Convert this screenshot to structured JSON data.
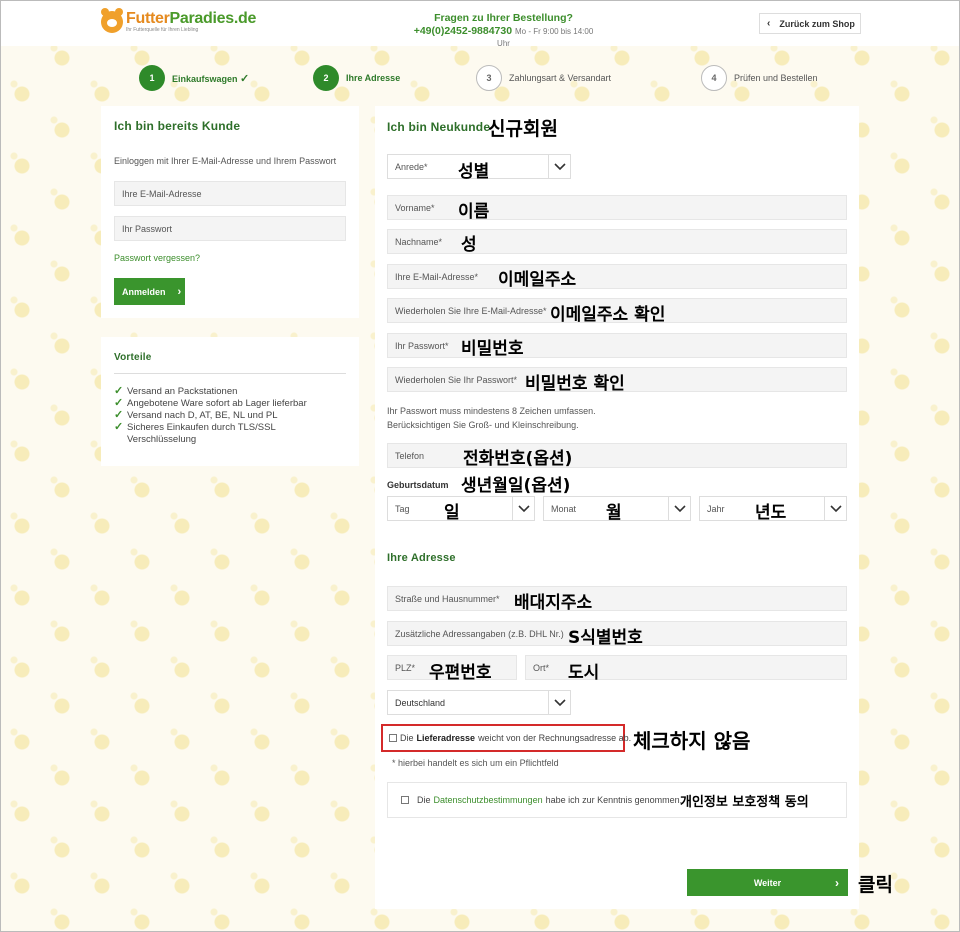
{
  "header": {
    "logo_name_a": "Futter",
    "logo_name_b": "Paradies.de",
    "logo_slogan": "Ihr Futterquelle für Ihren Liebling",
    "contact_question": "Fragen zu Ihrer Bestellung?",
    "contact_phone": "+49(0)2452-9884730",
    "contact_hours": "Mo - Fr 9:00 bis 14:00 Uhr",
    "back_label": "Zurück zum Shop"
  },
  "steps": [
    {
      "number": "1",
      "label": "Einkaufswagen",
      "check": "✓"
    },
    {
      "number": "2",
      "label": "Ihre Adresse"
    },
    {
      "number": "3",
      "label": "Zahlungsart & Versandart"
    },
    {
      "number": "4",
      "label": "Prüfen und Bestellen"
    }
  ],
  "login": {
    "title": "Ich bin bereits Kunde",
    "intro": "Einloggen mit Ihrer E-Mail-Adresse und Ihrem Passwort",
    "email_placeholder": "Ihre E-Mail-Adresse",
    "password_placeholder": "Ihr Passwort",
    "forgot": "Passwort vergessen?",
    "submit": "Anmelden"
  },
  "benefits": {
    "title": "Vorteile",
    "items": [
      "Versand an Packstationen",
      "Angebotene Ware sofort ab Lager lieferbar",
      "Versand nach D, AT, BE, NL und PL",
      "Sicheres Einkaufen durch TLS/SSL Verschlüsselung"
    ]
  },
  "register": {
    "title": "Ich bin Neukunde",
    "salutation": "Anrede*",
    "firstname": "Vorname*",
    "lastname": "Nachname*",
    "email": "Ihre E-Mail-Adresse*",
    "email_repeat": "Wiederholen Sie Ihre E-Mail-Adresse*",
    "password": "Ihr Passwort*",
    "password_repeat": "Wiederholen Sie Ihr Passwort*",
    "password_hint_1": "Ihr Passwort muss mindestens 8 Zeichen umfassen.",
    "password_hint_2": "Berücksichtigen Sie Groß- und Kleinschreibung.",
    "phone": "Telefon",
    "birthday_label": "Geburtsdatum",
    "day": "Tag",
    "month": "Monat",
    "year": "Jahr"
  },
  "address": {
    "title": "Ihre Adresse",
    "street": "Straße und Hausnummer*",
    "additional": "Zusätzliche Adressangaben (z.B. DHL Nr.)",
    "zip": "PLZ*",
    "city": "Ort*",
    "country": "Deutschland",
    "delivery_prefix": "Die",
    "delivery_bold": "Lieferadresse",
    "delivery_suffix": "weicht von der Rechnungsadresse ab.",
    "required_note": "* hierbei handelt es sich um ein Pflichtfeld",
    "privacy_prefix": "Die",
    "privacy_link": "Datenschutzbestimmungen",
    "privacy_suffix": "habe ich zur Kenntnis genommen.",
    "submit": "Weiter"
  },
  "annotations": {
    "new_member": "신규회원",
    "gender": "성별",
    "first_name": "이름",
    "last_name": "성",
    "email": "이메일주소",
    "email_confirm": "이메일주소 확인",
    "password": "비밀번호",
    "password_confirm": "비밀번호 확인",
    "phone": "전화번호(옵션)",
    "birthday": "생년월일(옵션)",
    "day": "일",
    "month": "월",
    "year": "년도",
    "address": "배대지주소",
    "identifier": "S식별번호",
    "zip": "우편번호",
    "city": "도시",
    "do_not_check": "체크하지 않음",
    "privacy_agree": "개인정보 보호정책 동의",
    "click": "클릭"
  },
  "colors": {
    "brand_green": "#3a952d",
    "brand_orange": "#e58a1f",
    "highlight_red": "#d42a2a"
  }
}
